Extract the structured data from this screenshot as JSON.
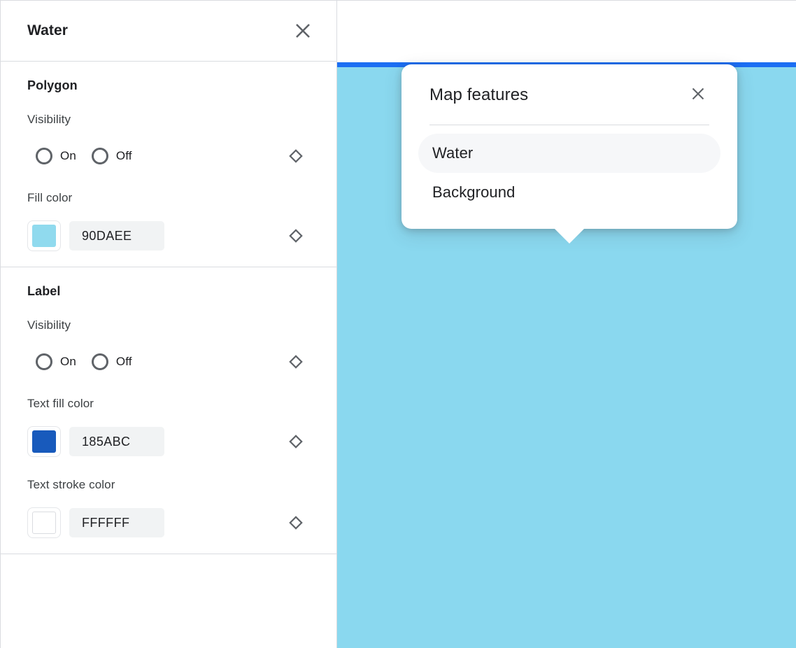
{
  "sidebar": {
    "title": "Water",
    "close_icon": "close-icon",
    "sections": [
      {
        "id": "polygon",
        "title": "Polygon",
        "fields": [
          {
            "id": "polygon-visibility",
            "type": "radio",
            "label": "Visibility",
            "options": [
              {
                "label": "On",
                "selected": false
              },
              {
                "label": "Off",
                "selected": false
              }
            ],
            "reset_icon": "diamond-icon"
          },
          {
            "id": "polygon-fill-color",
            "type": "color",
            "label": "Fill color",
            "value": "90DAEE",
            "swatch_color": "#90DAEE",
            "reset_icon": "diamond-icon"
          }
        ]
      },
      {
        "id": "label",
        "title": "Label",
        "fields": [
          {
            "id": "label-visibility",
            "type": "radio",
            "label": "Visibility",
            "options": [
              {
                "label": "On",
                "selected": false
              },
              {
                "label": "Off",
                "selected": false
              }
            ],
            "reset_icon": "diamond-icon"
          },
          {
            "id": "label-text-fill-color",
            "type": "color",
            "label": "Text fill color",
            "value": "185ABC",
            "swatch_color": "#185ABC",
            "reset_icon": "diamond-icon"
          },
          {
            "id": "label-text-stroke-color",
            "type": "color",
            "label": "Text stroke color",
            "value": "FFFFFF",
            "swatch_color": "#FFFFFF",
            "reset_icon": "diamond-icon"
          }
        ]
      }
    ]
  },
  "map": {
    "water_color": "#8AD8EF",
    "accent_bar_color": "#1B6EF3",
    "popup": {
      "title": "Map features",
      "close_icon": "close-icon",
      "items": [
        {
          "label": "Water",
          "selected": true
        },
        {
          "label": "Background",
          "selected": false
        }
      ]
    }
  }
}
